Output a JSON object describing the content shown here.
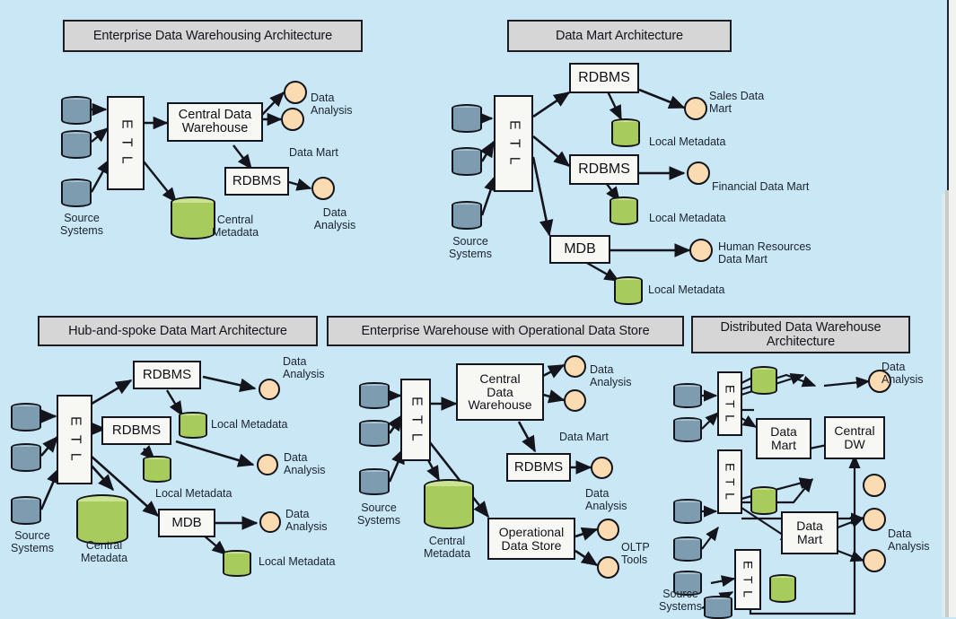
{
  "document": {
    "background_color": "#c9e7f5",
    "title_box_color": "#d6d6d6",
    "box_color": "#f7f8f3",
    "source_cylinder_color": "#7e9cb0",
    "metadata_cylinder_color": "#a7cc5c",
    "analysis_circle_color": "#fbdcb2",
    "line_color": "#14141c"
  },
  "panels": {
    "edw": {
      "title": "Enterprise Data Warehousing Architecture",
      "etl": "E T L",
      "central_dw": "Central Data\nWarehouse",
      "rdbms": "RDBMS",
      "source_systems": "Source\nSystems",
      "central_metadata": "Central\nMetadata",
      "data_mart": "Data Mart",
      "analysis_1": "Data\nAnalysis",
      "analysis_2": "Data\nAnalysis"
    },
    "datamart": {
      "title": "Data Mart Architecture",
      "etl": "E T L",
      "rdbms_1": "RDBMS",
      "rdbms_2": "RDBMS",
      "mdb": "MDB",
      "source_systems": "Source\nSystems",
      "sales_mart": "Sales Data\nMart",
      "financial_mart": "Financial Data Mart",
      "hr_mart": "Human Resources\nData Mart",
      "local_metadata_1": "Local Metadata",
      "local_metadata_2": "Local Metadata",
      "local_metadata_3": "Local Metadata"
    },
    "hubspoke": {
      "title": "Hub-and-spoke Data Mart Architecture",
      "etl": "E T L",
      "rdbms_1": "RDBMS",
      "rdbms_2": "RDBMS",
      "mdb": "MDB",
      "source_systems": "Source\nSystems",
      "central_metadata": "Central\nMetadata",
      "local_metadata_1": "Local Metadata",
      "local_metadata_2": "Local Metadata",
      "local_metadata_3": "Local Metadata",
      "analysis_1": "Data\nAnalysis",
      "analysis_2": "Data\nAnalysis",
      "analysis_3": "Data\nAnalysis"
    },
    "ods": {
      "title": "Enterprise Warehouse with Operational Data Store",
      "etl": "E T L",
      "central_dw": "Central\nData\nWarehouse",
      "rdbms": "RDBMS",
      "operational_store": "Operational\nData Store",
      "source_systems": "Source\nSystems",
      "central_metadata": "Central\nMetadata",
      "data_mart": "Data Mart",
      "analysis_1": "Data\nAnalysis",
      "analysis_2": "Data\nAnalysis",
      "oltp_tools": "OLTP\nTools"
    },
    "distributed": {
      "title": "Distributed Data Warehouse\nArchitecture",
      "etl_1": "E T L",
      "etl_2": "E T L",
      "etl_3": "E T L",
      "data_mart_1": "Data\nMart",
      "data_mart_2": "Data\nMart",
      "central_dw": "Central\nDW",
      "source_systems": "Source\nSystems",
      "analysis_1": "Data\nAnalysis",
      "analysis_2": "Data\nAnalysis"
    }
  }
}
